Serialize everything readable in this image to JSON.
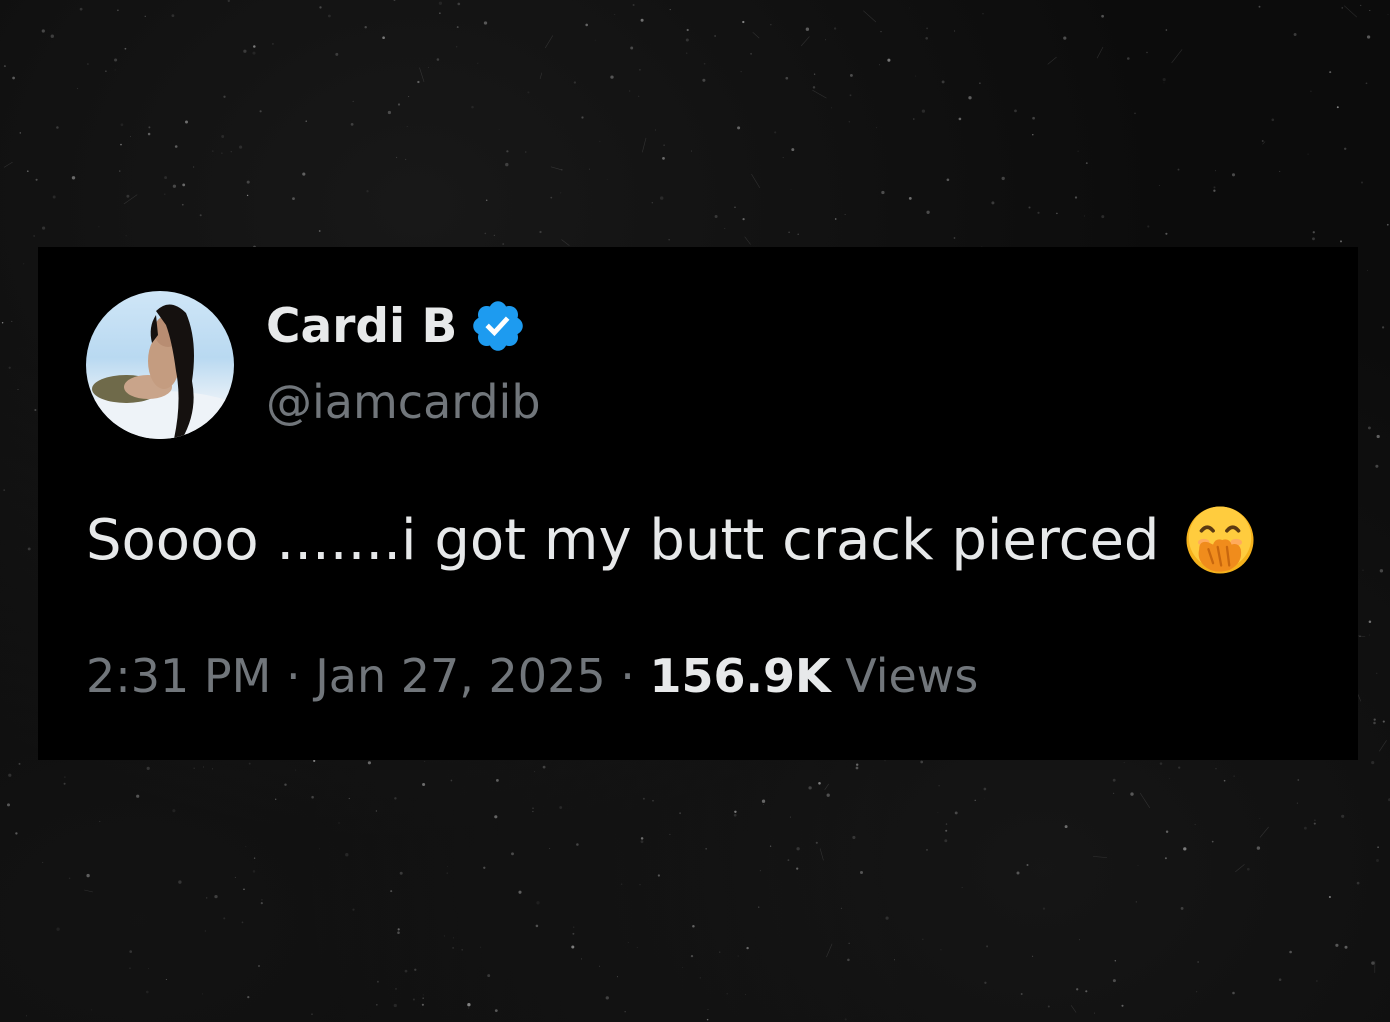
{
  "tweet": {
    "display_name": "Cardi B",
    "handle": "@iamcardib",
    "text": "Soooo .......i got my butt crack pierced",
    "time": "2:31 PM",
    "separator": " · ",
    "date": "Jan 27, 2025",
    "views_count": "156.9K",
    "views_label": " Views",
    "emoji": "face-with-hand-over-mouth-icon",
    "verified_icon": "verified-badge-icon"
  },
  "colors": {
    "background": "#0c0c0c",
    "card": "#000000",
    "primary_text": "#e7e9ea",
    "secondary_text": "#71767b",
    "verified_blue": "#1d9bf0",
    "emoji_yellow": "#f5b21c"
  }
}
